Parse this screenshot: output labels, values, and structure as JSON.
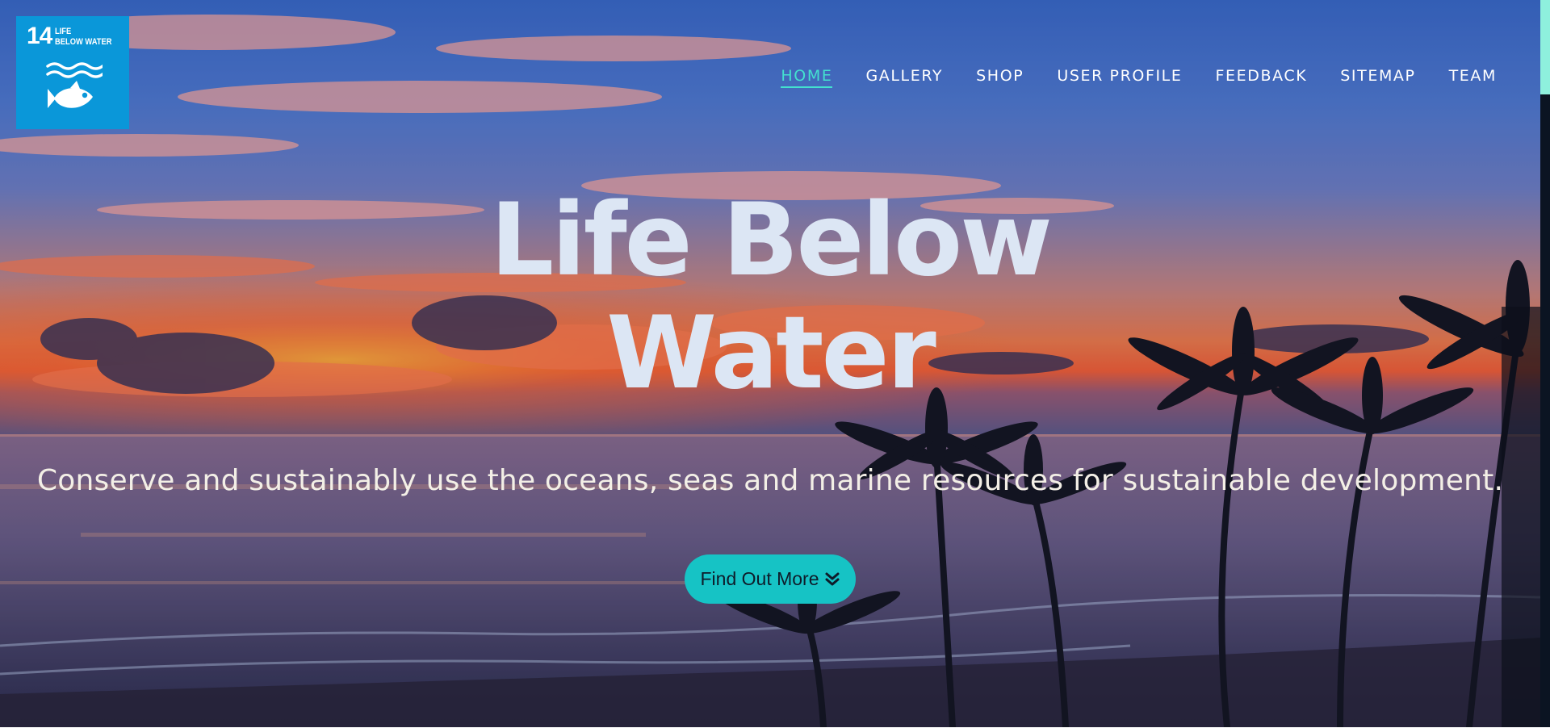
{
  "logo": {
    "number": "14",
    "line1": "LIFE",
    "line2": "BELOW WATER",
    "color": "#0a97d9",
    "icon": "fish-waves-icon"
  },
  "nav": {
    "items": [
      {
        "label": "HOME",
        "active": true
      },
      {
        "label": "GALLERY",
        "active": false
      },
      {
        "label": "SHOP",
        "active": false
      },
      {
        "label": "USER PROFILE",
        "active": false
      },
      {
        "label": "FEEDBACK",
        "active": false
      },
      {
        "label": "SITEMAP",
        "active": false
      },
      {
        "label": "TEAM",
        "active": false
      }
    ],
    "active_color": "#43e1cf"
  },
  "hero": {
    "title_line1": "Life Below",
    "title_line2": "Water",
    "subtitle": "Conserve and sustainably use the oceans, seas and marine resources for sustainable development.",
    "cta_label": "Find Out More",
    "cta_icon": "chevron-double-down-icon",
    "cta_color": "#16c3c5",
    "background": "sunset-ocean-palm-trees"
  },
  "colors": {
    "title": "#dce6f4",
    "subtitle": "#f3efe6",
    "scroll_thumb": "#8ef0dd"
  }
}
